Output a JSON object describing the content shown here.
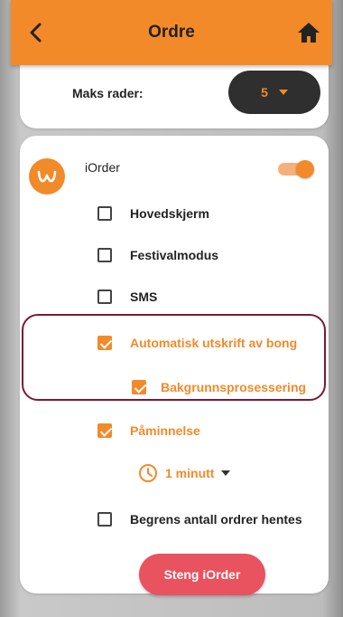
{
  "header": {
    "title": "Ordre"
  },
  "settings": {
    "max_rows_label": "Maks rader:",
    "max_rows_value": "5"
  },
  "iorder": {
    "name": "iOrder",
    "enabled": true,
    "options": [
      {
        "label": "Hovedskjerm",
        "checked": false
      },
      {
        "label": "Festivalmodus",
        "checked": false
      },
      {
        "label": "SMS",
        "checked": false
      },
      {
        "label": "Automatisk utskrift av bong",
        "checked": true
      },
      {
        "label": "Bakgrunnsprosessering",
        "checked": true
      },
      {
        "label": "Påminnelse",
        "checked": true
      },
      {
        "label": "Begrens antall ordrer hentes",
        "checked": false
      }
    ],
    "reminder_interval": "1 minutt",
    "stop_button": "Steng iOrder"
  },
  "colors": {
    "accent": "#f28a2a",
    "highlight_border": "#7a1a34",
    "stop_button": "#e8535f"
  },
  "icons": [
    "back-arrow-icon",
    "home-icon",
    "iorder-logo-icon",
    "clock-icon"
  ]
}
